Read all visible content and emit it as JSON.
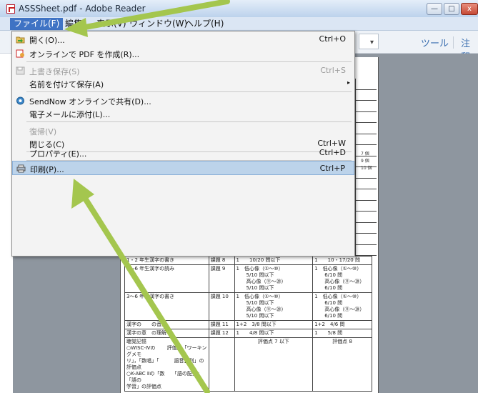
{
  "window": {
    "title": "ASSSheet.pdf - Adobe Reader",
    "btn_min": "—",
    "btn_max": "□",
    "btn_close": "x"
  },
  "menubar": {
    "file": "ファイル(F)",
    "edit": "編集",
    "view": "表示(V)",
    "window": "ウィンドウ(W)",
    "help": "ヘルプ(H)"
  },
  "toolbar": {
    "tools": "ツール",
    "comment": "注釈",
    "dropdown_arrow": "▾"
  },
  "file_menu": {
    "items": [
      {
        "label": "開く(O)...",
        "shortcut": "Ctrl+O",
        "icon": "open-folder-icon"
      },
      {
        "label": "オンラインで PDF を作成(R)...",
        "shortcut": "",
        "icon": "create-pdf-icon"
      },
      {
        "label": "上書き保存(S)",
        "shortcut": "Ctrl+S",
        "icon": "save-icon"
      },
      {
        "label": "名前を付けて保存(A)",
        "shortcut": "",
        "arrow": "▸"
      },
      {
        "label": "SendNow オンラインで共有(D)...",
        "shortcut": "",
        "icon": "sendnow-icon"
      },
      {
        "label": "電子メールに添付(L)...",
        "shortcut": ""
      },
      {
        "label": "復帰(V)",
        "shortcut": ""
      },
      {
        "label": "閉じる(C)",
        "shortcut": "Ctrl+W"
      },
      {
        "label": "プロパティ(E)...",
        "shortcut": "Ctrl+D"
      },
      {
        "label": "印刷(P)...",
        "shortcut": "Ctrl+P",
        "icon": "printer-icon"
      }
    ]
  },
  "document": {
    "right_notes": [
      "7 個",
      "9 個",
      "10 個"
    ],
    "rows": [
      {
        "c1": "1・2 年生漢字の書き",
        "c2": "課題 8",
        "c3": [
          "1　　10/20 問以下"
        ],
        "c4": [
          "1　　10・17/20 問"
        ]
      },
      {
        "c1": "3～6 年生漢字の読み",
        "c2": "課題 9",
        "c3": [
          "1　低心像（①～⑩）",
          "　　5/10 問以下",
          "　　高心像（⑪～⑳）",
          "　　5/10 問以下"
        ],
        "c4": [
          "1　低心像（①～⑩）",
          "　　6/10 問",
          "　　高心像（⑪～⑳）",
          "　　6/10 問"
        ]
      },
      {
        "c1": "3～6 年生漢字の書き",
        "c2": "課題 10",
        "c3": [
          "1　低心像（①～⑩）",
          "　　5/10 問以下",
          "　　高心像（⑪～⑳）",
          "　　5/10 問以下"
        ],
        "c4": [
          "1　低心像（①～⑩）",
          "　　6/10 問",
          "　　高心像（⑪～⑳）",
          "　　6/10 問"
        ]
      },
      {
        "c1": "漢字の　　の音韻",
        "c2": "課題 11",
        "c3": [
          "1+2　3/8 問以下"
        ],
        "c4": [
          "1+2　4/6 問"
        ]
      },
      {
        "c1": "漢字の意　の理解",
        "c2": "課題 12",
        "c3": [
          "1　　4/8 問以下"
        ],
        "c4": [
          "1　　5/8 問"
        ]
      },
      {
        "c1": "聴覚記憶",
        "c2": "",
        "c3": [
          "評価点 7 以下"
        ],
        "c4": [
          "評価点 8"
        ]
      }
    ],
    "footnote": [
      "○WISC-Ⅳの　　 評価点「ワーキングメモ",
      "リ」，「数唱」「　　　語音整列」の評価点",
      "○K-ABC Ⅱの「数　　「語の配列」「語の",
      "学習」の評価点"
    ]
  }
}
